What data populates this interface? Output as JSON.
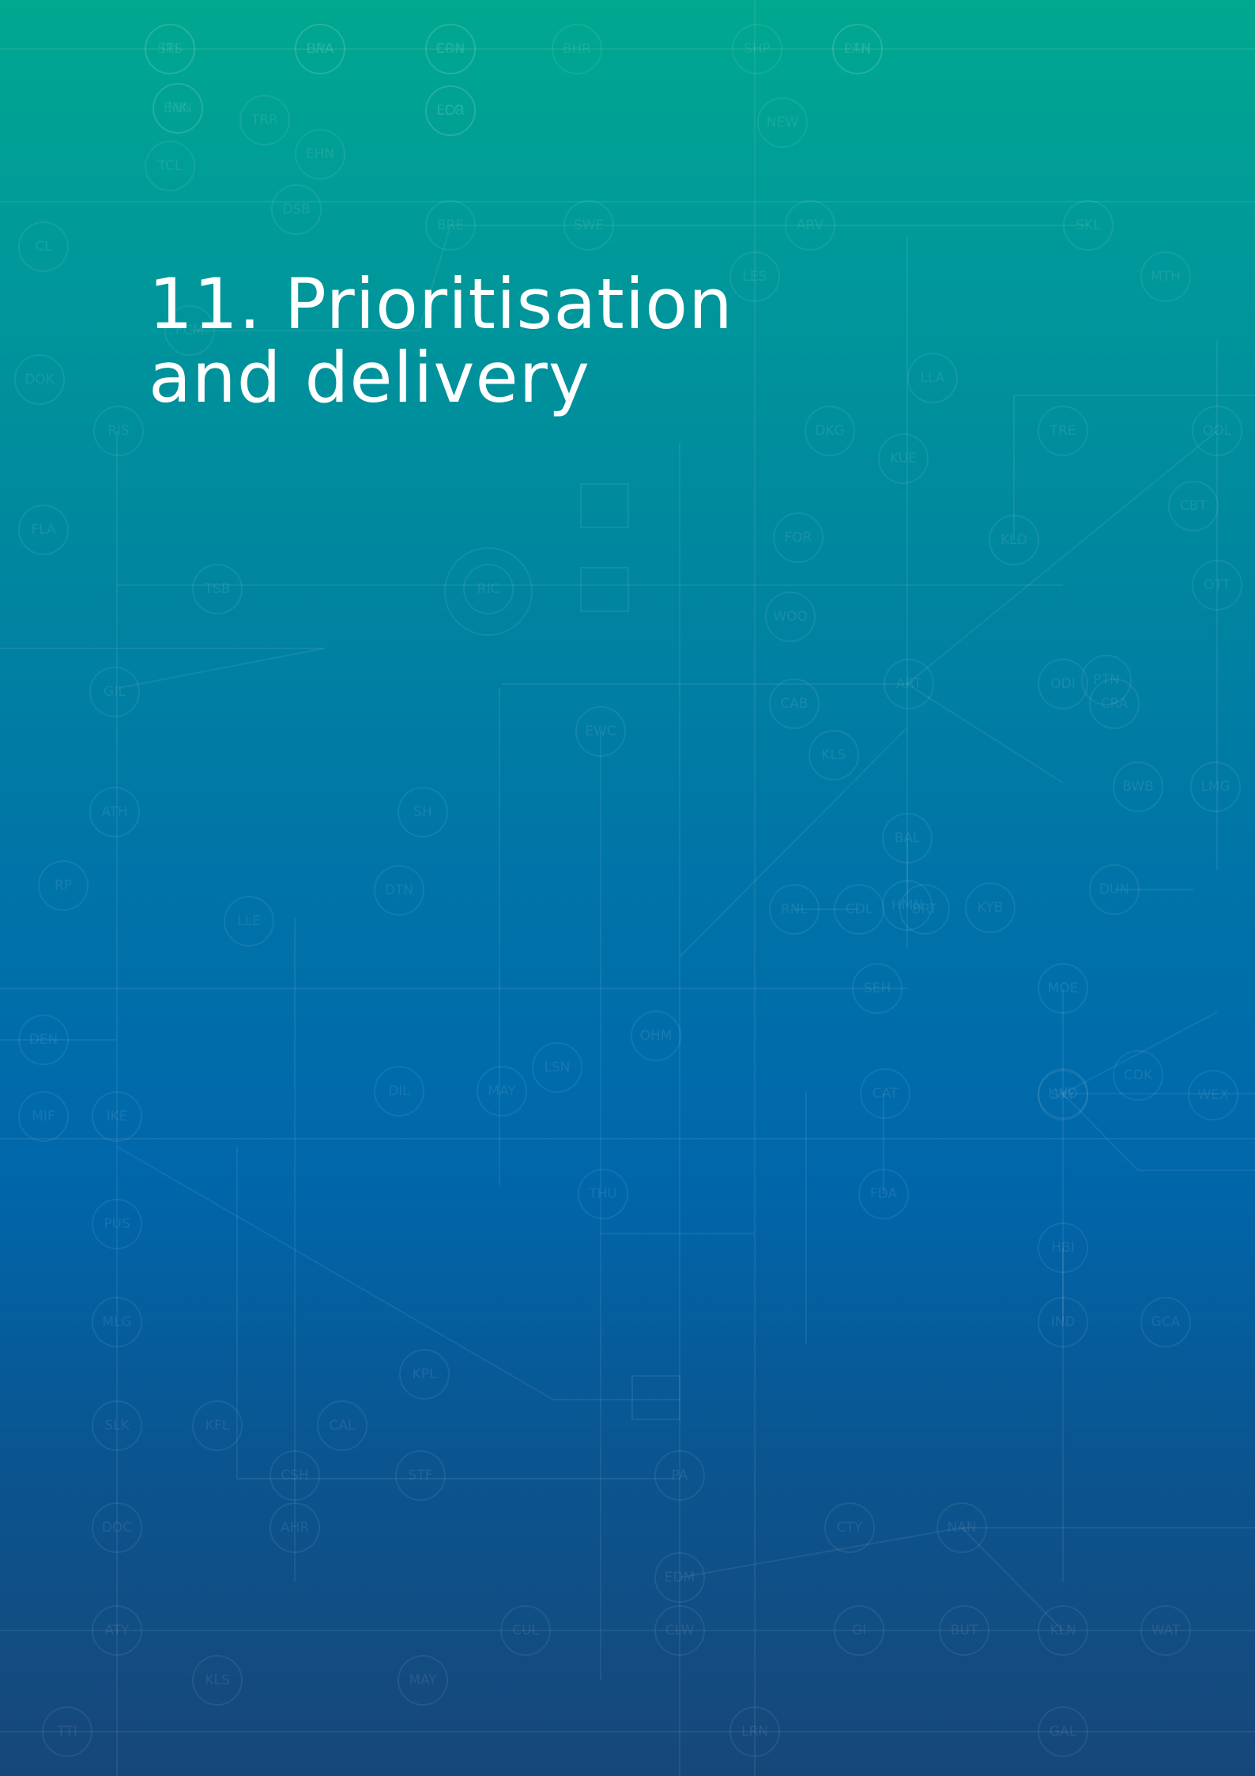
{
  "section": {
    "title_line1": "11. Prioritisation",
    "title_line2": "and delivery"
  },
  "background": {
    "description_icon": "network-map-icon",
    "gradient_top": "#00a88f",
    "gradient_bottom": "#174779",
    "nodes": [
      "STS",
      "LWA",
      "CON",
      "MK",
      "LAN",
      "EDR",
      "NEW",
      "BHR",
      "SHP",
      "TCL",
      "TRR",
      "EHN",
      "DSB",
      "CL",
      "BRE",
      "SWE",
      "ARV",
      "SKL",
      "LES",
      "MTH",
      "DOK",
      "FCM",
      "RIS",
      "FLA",
      "LLA",
      "GIL",
      "ATH",
      "SH",
      "RP",
      "DTN",
      "TSB",
      "RIC",
      "EWC",
      "FOR",
      "WOO",
      "KLS",
      "DEN",
      "LLE",
      "OHM",
      "MIF",
      "IKE",
      "DIL",
      "MAY",
      "LSN",
      "THU",
      "PUS",
      "MLG",
      "SLK",
      "KFL",
      "CAL",
      "KPL",
      "CSH",
      "DOC",
      "AHR",
      "STF",
      "PA",
      "EDM",
      "ATY",
      "CLW",
      "KLS",
      "MAY",
      "CUL",
      "GI",
      "BUT",
      "KLN",
      "WAT",
      "WEX",
      "COK",
      "LWD",
      "CAT",
      "FDA",
      "HBI",
      "IND",
      "GCA",
      "NAN",
      "CTY",
      "TTI",
      "ODI",
      "CRA",
      "BWB",
      "LMG",
      "DUN",
      "OOL",
      "KLD",
      "PTN",
      "ART",
      "CAB",
      "BAL",
      "HMN",
      "RNL",
      "CDL",
      "BRT",
      "KYB",
      "SEH",
      "MOE",
      "SKY",
      "CBT",
      "DKG",
      "KUE",
      "OTT",
      "TRE",
      "LRN",
      "GAL",
      "IRI",
      "BRA",
      "ERN",
      "ENN",
      "PTH",
      "LCO"
    ]
  }
}
